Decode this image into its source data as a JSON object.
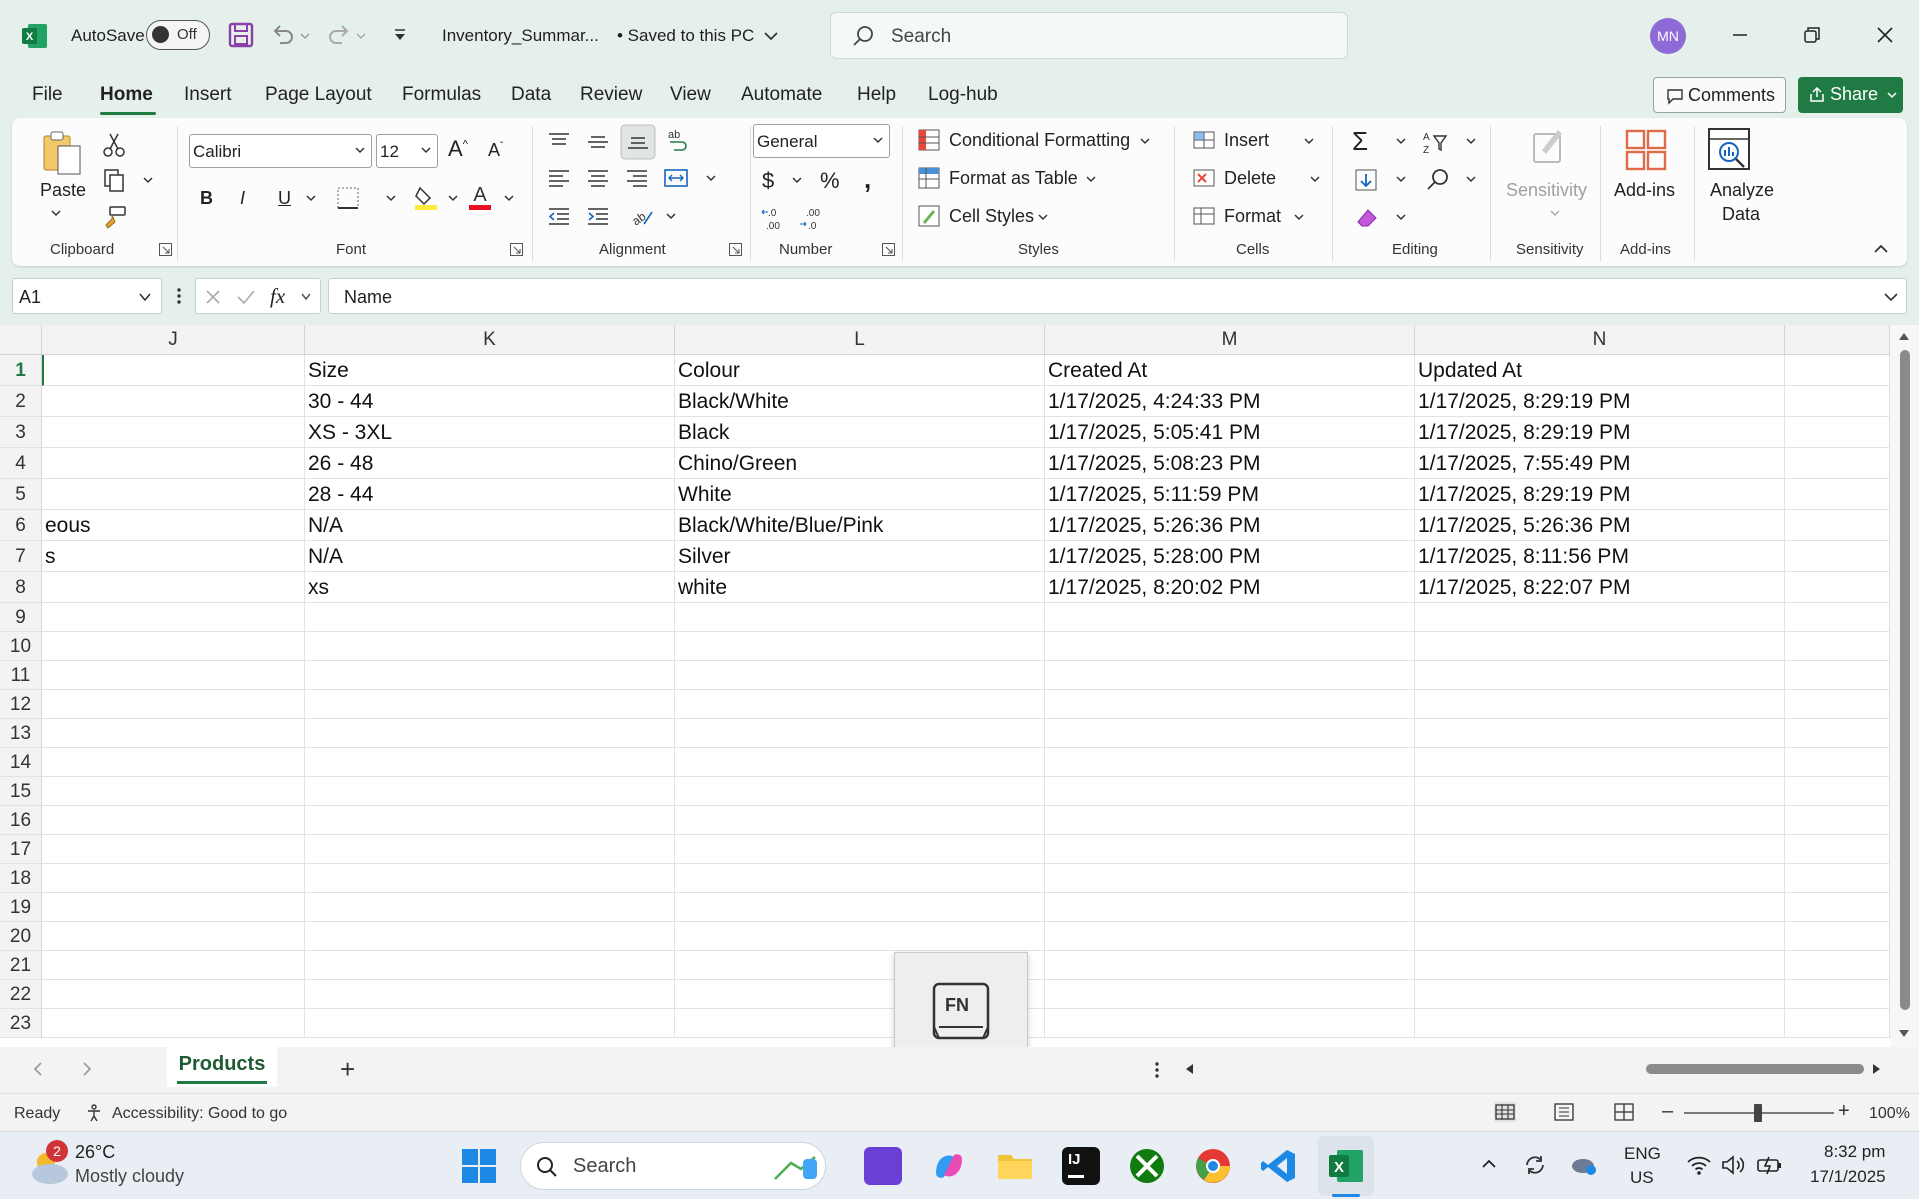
{
  "titlebar": {
    "autosave_label": "AutoSave",
    "autosave_state": "Off",
    "filename": "Inventory_Summar...",
    "save_status": "• Saved to this PC",
    "search_placeholder": "Search",
    "user_initials": "MN"
  },
  "tabs": [
    "File",
    "Home",
    "Insert",
    "Page Layout",
    "Formulas",
    "Data",
    "Review",
    "View",
    "Automate",
    "Help",
    "Log-hub"
  ],
  "tabs_active": "Home",
  "ribbon_actions": {
    "comments": "Comments",
    "share": "Share"
  },
  "ribbon": {
    "clipboard": {
      "label": "Clipboard",
      "paste": "Paste"
    },
    "font": {
      "label": "Font",
      "name": "Calibri",
      "size": "12",
      "bold": "B",
      "italic": "I",
      "underline": "U"
    },
    "alignment": {
      "label": "Alignment"
    },
    "number": {
      "label": "Number",
      "format": "General",
      "currency": "$",
      "percent": "%"
    },
    "styles": {
      "label": "Styles",
      "conditional": "Conditional Formatting",
      "format_table": "Format as Table",
      "cell_styles": "Cell Styles"
    },
    "cells": {
      "label": "Cells",
      "insert": "Insert",
      "delete": "Delete",
      "format": "Format"
    },
    "editing": {
      "label": "Editing"
    },
    "sensitivity": {
      "label": "Sensitivity",
      "button": "Sensitivity"
    },
    "addins": {
      "label": "Add-ins",
      "button": "Add-ins"
    },
    "analyze": {
      "button_line1": "Analyze",
      "button_line2": "Data"
    }
  },
  "formula_bar": {
    "cell_ref": "A1",
    "fx": "fx",
    "content": "Name"
  },
  "columns": [
    {
      "letter": "J"
    },
    {
      "letter": "K"
    },
    {
      "letter": "L"
    },
    {
      "letter": "M"
    },
    {
      "letter": "N"
    }
  ],
  "row_numbers": [
    "1",
    "2",
    "3",
    "4",
    "5",
    "6",
    "7",
    "8",
    "9",
    "10",
    "11",
    "12",
    "13",
    "14",
    "15",
    "16",
    "17",
    "18",
    "19",
    "20",
    "21",
    "22",
    "23"
  ],
  "rows": [
    [
      "",
      "Size",
      "Colour",
      "Created At",
      "Updated At"
    ],
    [
      "",
      "30 - 44",
      "Black/White",
      "1/17/2025, 4:24:33 PM",
      "1/17/2025, 8:29:19 PM"
    ],
    [
      "",
      "XS - 3XL",
      "Black",
      "1/17/2025, 5:05:41 PM",
      "1/17/2025, 8:29:19 PM"
    ],
    [
      "",
      "26 - 48",
      "Chino/Green",
      "1/17/2025, 5:08:23 PM",
      "1/17/2025, 7:55:49 PM"
    ],
    [
      "",
      "28 - 44",
      "White",
      "1/17/2025, 5:11:59 PM",
      "1/17/2025, 8:29:19 PM"
    ],
    [
      "eous",
      "N/A",
      "Black/White/Blue/Pink",
      "1/17/2025, 5:26:36 PM",
      "1/17/2025, 5:26:36 PM"
    ],
    [
      "s",
      "N/A",
      "Silver",
      "1/17/2025, 5:28:00 PM",
      "1/17/2025, 8:11:56 PM"
    ],
    [
      "",
      "xs",
      "white",
      "1/17/2025, 8:20:02 PM",
      "1/17/2025, 8:22:07 PM"
    ]
  ],
  "fn_popup": "FN",
  "sheets": {
    "active": "Products",
    "add": "+"
  },
  "statusbar": {
    "ready": "Ready",
    "accessibility": "Accessibility: Good to go",
    "zoom": "100%"
  },
  "taskbar": {
    "weather_badge": "2",
    "temperature": "26°C",
    "condition": "Mostly cloudy",
    "search_placeholder": "Search",
    "lang_line1": "ENG",
    "lang_line2": "US",
    "time": "8:32 pm",
    "date": "17/1/2025"
  },
  "colors": {
    "accent": "#1f7a44",
    "excel_green": "#107c41",
    "avatar": "#8e6ad6",
    "badge": "#d13438"
  }
}
